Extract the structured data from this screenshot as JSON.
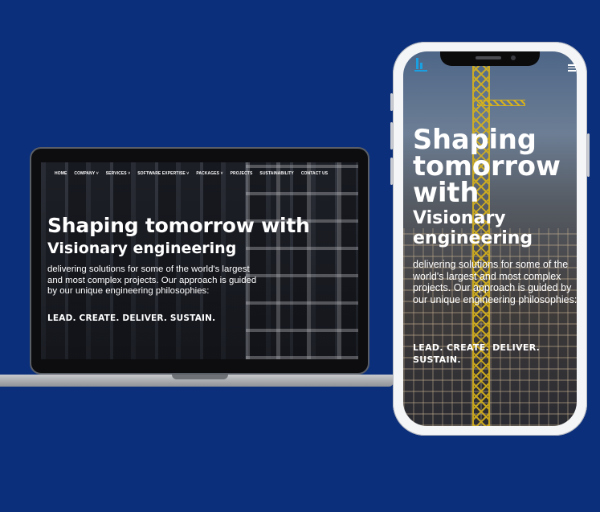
{
  "laptop": {
    "nav": [
      "HOME",
      "COMPANY ˅",
      "SERVICES ˅",
      "SOFTWARE EXPERTISE ˅",
      "PACKAGES ˅",
      "PROJECTS",
      "SUSTAINABILITY",
      "CONTACT US"
    ],
    "hero": {
      "title": "Shaping tomorrow with",
      "subtitle": "Visionary engineering",
      "description": "delivering solutions for some of the world's largest and most complex projects. Our approach is guided by our unique engineering philosophies:",
      "tagline": "LEAD. CREATE. DELIVER. SUSTAIN."
    }
  },
  "phone": {
    "hero": {
      "title": "Shaping tomorrow with",
      "subtitle": "Visionary engineering",
      "description": "delivering solutions for some of the world's largest and most complex projects. Our approach is guided by our unique engineering philosophies:",
      "tagline": "LEAD. CREATE. DELIVER. SUSTAIN."
    },
    "icons": {
      "logo": "company-logo-icon",
      "menu": "hamburger-menu-icon"
    }
  },
  "colors": {
    "background": "#0b2f7a",
    "accent": "#1aa0e0",
    "text": "#ffffff"
  }
}
